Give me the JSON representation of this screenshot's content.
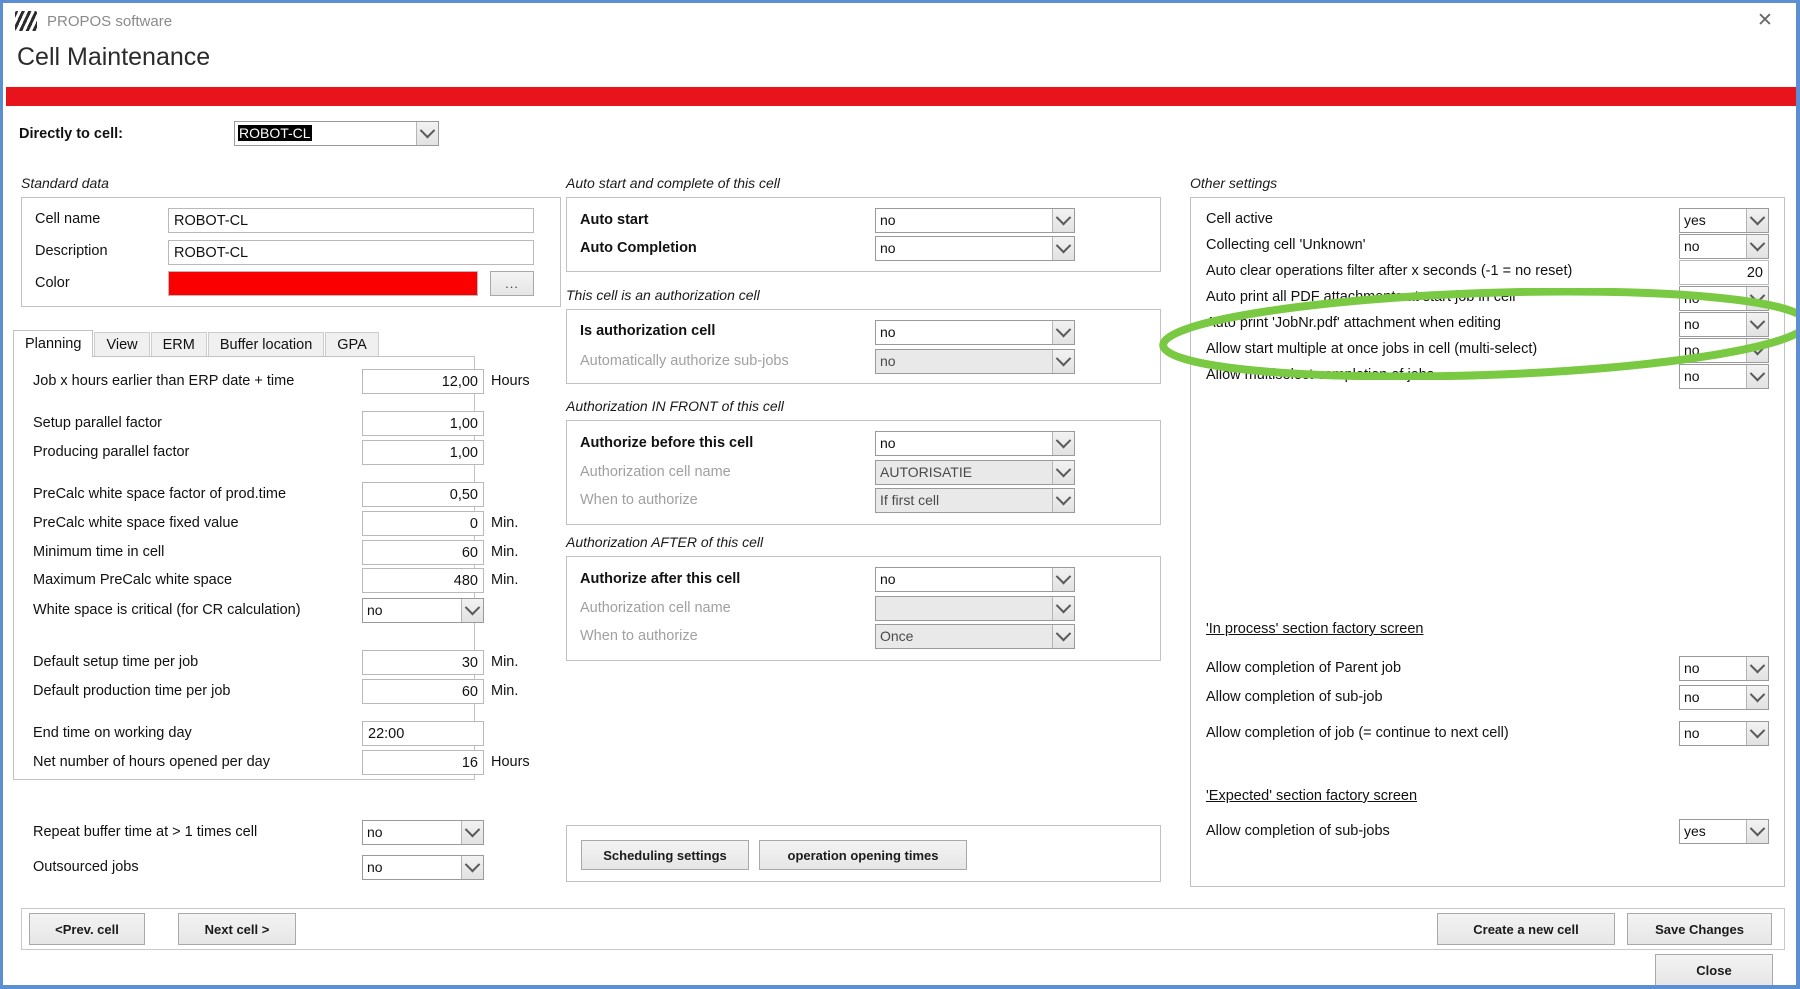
{
  "window": {
    "app_title": "PROPOS software",
    "page_title": "Cell Maintenance",
    "close_icon": "close-icon",
    "logo_icon": "propos-logo-icon",
    "accent_color": "#e8141c",
    "annotation_color": "#7ac943"
  },
  "top": {
    "directly_to_cell_label": "Directly to cell:",
    "directly_to_cell_value": "ROBOT-CL"
  },
  "standard_data": {
    "caption": "Standard data",
    "cell_name_label": "Cell name",
    "cell_name_value": "ROBOT-CL",
    "description_label": "Description",
    "description_value": "ROBOT-CL",
    "color_label": "Color",
    "color_value": "#fa0000",
    "color_browse_label": "..."
  },
  "tabs": [
    {
      "label": "Planning",
      "active": true
    },
    {
      "label": "View",
      "active": false
    },
    {
      "label": "ERM",
      "active": false
    },
    {
      "label": "Buffer location",
      "active": false
    },
    {
      "label": "GPA",
      "active": false
    }
  ],
  "planning": {
    "rows": [
      {
        "label": "Job x hours earlier than ERP date + time",
        "value": "12,00",
        "unit": "Hours",
        "type": "number"
      },
      {
        "label": "Setup parallel factor",
        "value": "1,00",
        "unit": "",
        "type": "number"
      },
      {
        "label": "Producing parallel factor",
        "value": "1,00",
        "unit": "",
        "type": "number"
      },
      {
        "label": "PreCalc white space factor of prod.time",
        "value": "0,50",
        "unit": "",
        "type": "number"
      },
      {
        "label": "PreCalc white space fixed value",
        "value": "0",
        "unit": "Min.",
        "type": "number"
      },
      {
        "label": "Minimum time in cell",
        "value": "60",
        "unit": "Min.",
        "type": "number"
      },
      {
        "label": "Maximum PreCalc white space",
        "value": "480",
        "unit": "Min.",
        "type": "number"
      },
      {
        "label": "White space is critical (for CR calculation)",
        "value": "no",
        "unit": "",
        "type": "combo"
      },
      {
        "label": "Default setup time per job",
        "value": "30",
        "unit": "Min.",
        "type": "number"
      },
      {
        "label": "Default production time per job",
        "value": "60",
        "unit": "Min.",
        "type": "number"
      },
      {
        "label": "End time on working day",
        "value": "22:00",
        "unit": "",
        "type": "text"
      },
      {
        "label": "Net number of hours opened per day",
        "value": "16",
        "unit": "Hours",
        "type": "number"
      },
      {
        "label": "Repeat buffer time at > 1 times cell",
        "value": "no",
        "unit": "",
        "type": "combo"
      },
      {
        "label": "Outsourced jobs",
        "value": "no",
        "unit": "",
        "type": "combo"
      }
    ]
  },
  "auto_start": {
    "caption": "Auto start and complete of this cell",
    "rows": [
      {
        "label": "Auto start",
        "value": "no",
        "disabled": false
      },
      {
        "label": "Auto Completion",
        "value": "no",
        "disabled": false
      }
    ]
  },
  "authorization_cell": {
    "caption": "This cell is an authorization cell",
    "rows": [
      {
        "label": "Is authorization cell",
        "value": "no",
        "disabled": false
      },
      {
        "label": "Automatically authorize sub-jobs",
        "value": "no",
        "disabled": true
      }
    ]
  },
  "authorization_front": {
    "caption": "Authorization IN FRONT of this cell",
    "rows": [
      {
        "label": "Authorize before this cell",
        "value": "no",
        "disabled": false
      },
      {
        "label": "Authorization cell name",
        "value": "AUTORISATIE",
        "disabled": true
      },
      {
        "label": "When to authorize",
        "value": "If first cell",
        "disabled": true
      }
    ]
  },
  "authorization_after": {
    "caption": "Authorization AFTER of this cell",
    "rows": [
      {
        "label": "Authorize after this cell",
        "value": "no",
        "disabled": false
      },
      {
        "label": "Authorization cell name",
        "value": "",
        "disabled": true
      },
      {
        "label": "When to authorize",
        "value": "Once",
        "disabled": true
      }
    ]
  },
  "middle_buttons": {
    "scheduling_settings": "Scheduling settings",
    "operation_opening_times": "operation opening times"
  },
  "other_settings": {
    "caption": "Other settings",
    "rows": [
      {
        "label": "Cell active",
        "value": "yes",
        "type": "combo"
      },
      {
        "label": "Collecting cell 'Unknown'",
        "value": "no",
        "type": "combo"
      },
      {
        "label": "Auto clear operations filter after x seconds (-1 = no reset)",
        "value": "20",
        "type": "number"
      },
      {
        "label": "Auto print all PDF attachments at start job in cell",
        "value": "no",
        "type": "combo"
      },
      {
        "label": "Auto print 'JobNr.pdf' attachment when editing",
        "value": "no",
        "type": "combo"
      },
      {
        "label": "Allow start multiple at once jobs in cell (multi-select)",
        "value": "no",
        "type": "combo"
      },
      {
        "label": "Allow multiselect completion of jobs",
        "value": "no",
        "type": "combo"
      }
    ],
    "in_process_header": "'In process' section factory screen",
    "in_process_rows": [
      {
        "label": "Allow completion of Parent job",
        "value": "no"
      },
      {
        "label": "Allow completion of sub-job",
        "value": "no"
      },
      {
        "label": "Allow completion of job  (= continue to next cell)",
        "value": "no"
      }
    ],
    "expected_header": "'Expected' section factory screen",
    "expected_rows": [
      {
        "label": "Allow completion of sub-jobs",
        "value": "yes"
      }
    ]
  },
  "footer": {
    "prev_cell": "<Prev. cell",
    "next_cell": "Next cell >",
    "create_new_cell": "Create a new cell",
    "save_changes": "Save Changes",
    "close": "Close"
  }
}
